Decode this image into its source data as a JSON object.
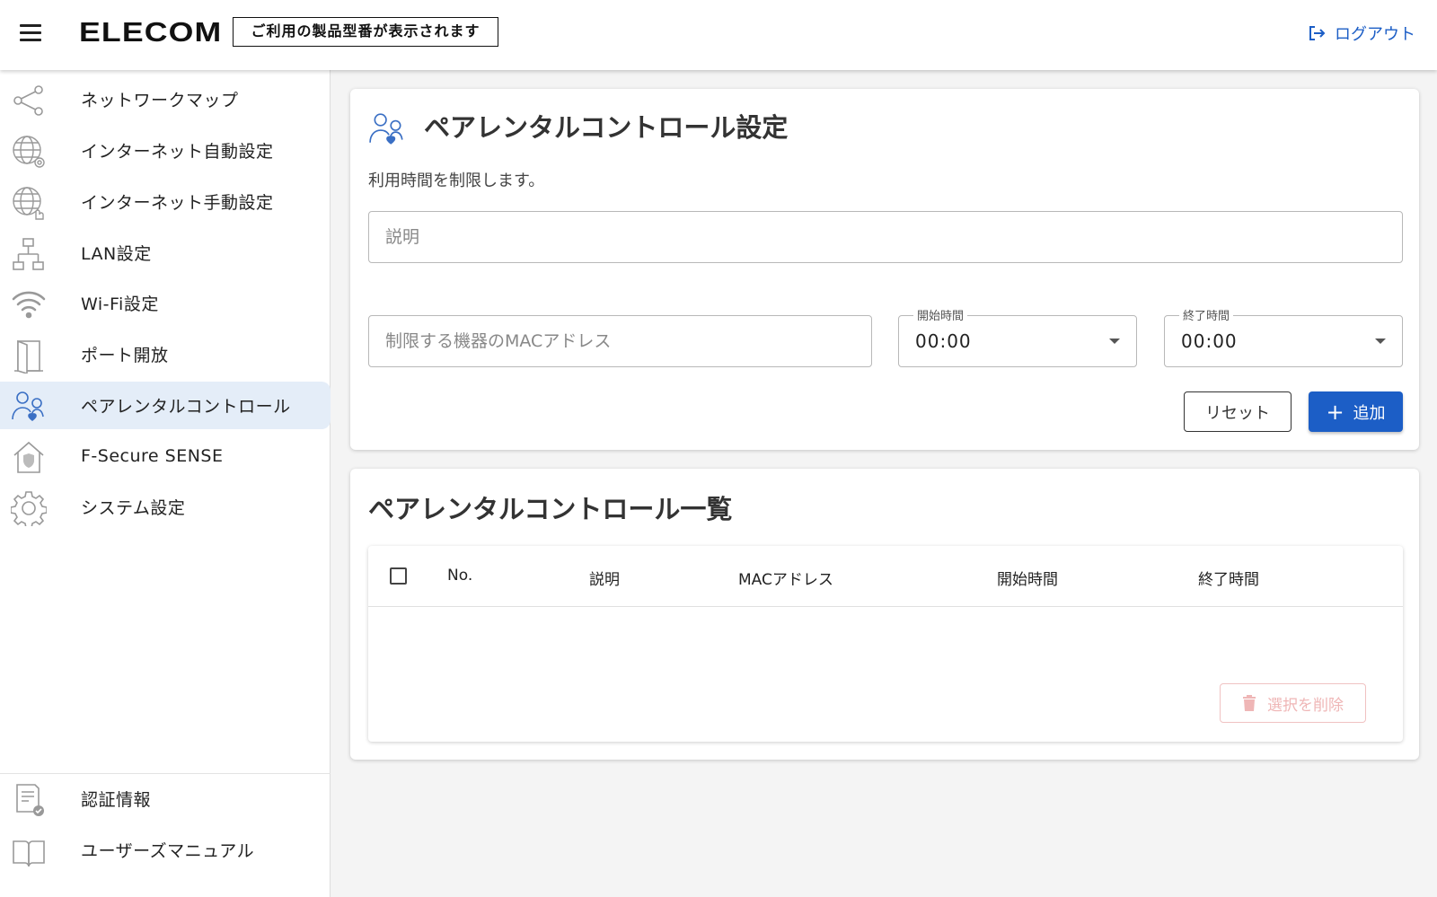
{
  "header": {
    "logo": "ELECOM",
    "model_notice": "ご利用の製品型番が表示されます",
    "logout_label": "ログアウト"
  },
  "sidebar": {
    "items": [
      {
        "label": "ネットワークマップ",
        "icon": "network-map-icon"
      },
      {
        "label": "インターネット自動設定",
        "icon": "globe-auto-icon"
      },
      {
        "label": "インターネット手動設定",
        "icon": "globe-manual-icon"
      },
      {
        "label": "LAN設定",
        "icon": "lan-icon"
      },
      {
        "label": "Wi-Fi設定",
        "icon": "wifi-icon"
      },
      {
        "label": "ポート開放",
        "icon": "door-icon"
      },
      {
        "label": "ペアレンタルコントロール",
        "icon": "parental-icon",
        "active": true
      },
      {
        "label": "F-Secure SENSE",
        "icon": "shield-home-icon"
      },
      {
        "label": "システム設定",
        "icon": "gear-icon"
      }
    ],
    "bottom_items": [
      {
        "label": "認証情報",
        "icon": "certificate-icon"
      },
      {
        "label": "ユーザーズマニュアル",
        "icon": "manual-icon"
      }
    ]
  },
  "settings_card": {
    "title": "ペアレンタルコントロール設定",
    "description": "利用時間を制限します。",
    "desc_placeholder": "説明",
    "mac_placeholder": "制限する機器のMACアドレス",
    "start_label": "開始時間",
    "start_value": "00:00",
    "end_label": "終了時間",
    "end_value": "00:00",
    "reset_label": "リセット",
    "add_label": "追加"
  },
  "list_card": {
    "title": "ペアレンタルコントロール一覧",
    "columns": [
      "No.",
      "説明",
      "MACアドレス",
      "開始時間",
      "終了時間"
    ],
    "rows": [],
    "delete_label": "選択を削除"
  },
  "colors": {
    "accent": "#1c5ec6",
    "active_bg": "#e4edf8",
    "disabled_red": "#efb6b6"
  }
}
